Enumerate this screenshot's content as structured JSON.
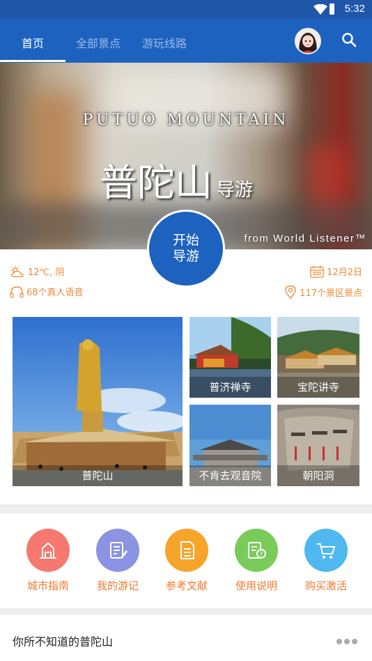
{
  "status_bar": {
    "time": "5:32"
  },
  "tabs": [
    {
      "label": "首页",
      "active": true
    },
    {
      "label": "全部景点",
      "active": false
    },
    {
      "label": "游玩线路",
      "active": false
    }
  ],
  "banner": {
    "title_en": "PUTUO MOUNTAIN",
    "title_cn": "普陀山",
    "title_cn_suffix": "导游",
    "credit": "from World Listener™"
  },
  "start_button": {
    "line1": "开始",
    "line2": "导游"
  },
  "info": {
    "weather": "12℃, 阴",
    "date": "12月2日",
    "voices": "68个真人语音",
    "spots": "117个景区景点"
  },
  "attractions": [
    {
      "name": "普陀山"
    },
    {
      "name": "普济禅寺"
    },
    {
      "name": "宝陀讲寺"
    },
    {
      "name": "不肯去观音院"
    },
    {
      "name": "朝阳洞"
    }
  ],
  "functions": [
    {
      "label": "城市指南",
      "icon": "city-guide-icon",
      "color": "#f6786f"
    },
    {
      "label": "我的游记",
      "icon": "travel-notes-icon",
      "color": "#8b93e2"
    },
    {
      "label": "参考文献",
      "icon": "references-icon",
      "color": "#f7a42a"
    },
    {
      "label": "使用说明",
      "icon": "instructions-icon",
      "color": "#79cc5a"
    },
    {
      "label": "购买激活",
      "icon": "cart-icon",
      "color": "#4fb9ef"
    }
  ],
  "section": {
    "title": "你所不知道的普陀山"
  },
  "colors": {
    "primary": "#1d62bf",
    "accent": "#ee8a37"
  }
}
